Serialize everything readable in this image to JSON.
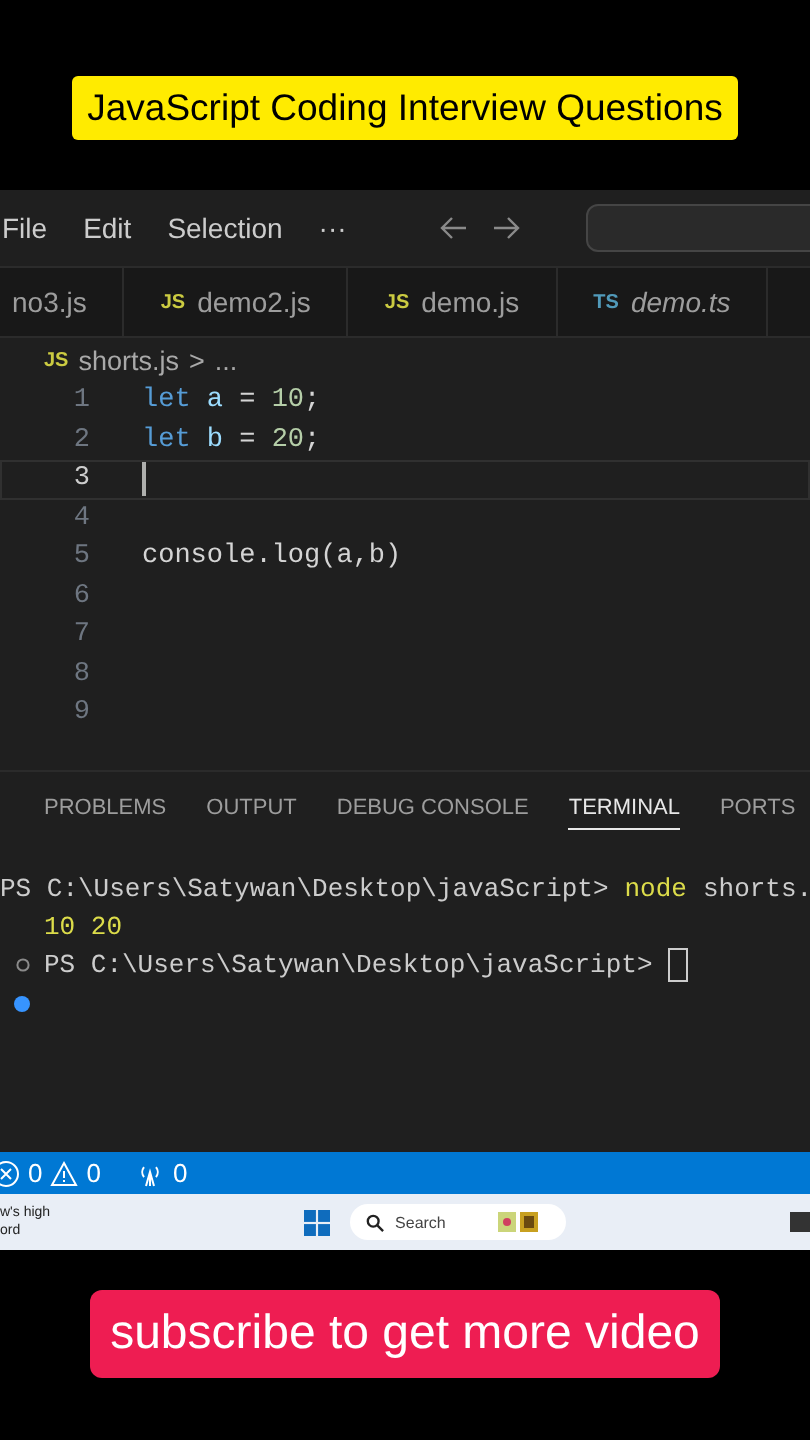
{
  "top_banner": {
    "text": "JavaScript Coding Interview Questions"
  },
  "menu": [
    "File",
    "Edit",
    "Selection",
    "···"
  ],
  "tabs": [
    {
      "label": "no3.js",
      "preview": false,
      "selected": false
    },
    {
      "label": "demo2.js",
      "icon": "JS",
      "preview": false,
      "selected": false
    },
    {
      "label": "demo.js",
      "icon": "JS",
      "preview": false,
      "selected": false
    },
    {
      "label": "demo.ts",
      "icon": "TS",
      "preview": true,
      "selected": false
    }
  ],
  "breadcrumb": {
    "icon": "JS",
    "file": "shorts.js",
    "separator": ">",
    "rest": "..."
  },
  "editor": {
    "lines": [
      {
        "number": "1",
        "current": false,
        "tokens": [
          {
            "kind": "keyword",
            "text": "let"
          },
          {
            "kind": "variable",
            "text": " a"
          },
          {
            "kind": "plain",
            "text": " = "
          },
          {
            "kind": "number",
            "text": "10"
          },
          {
            "kind": "plain",
            "text": ";"
          }
        ]
      },
      {
        "number": "2",
        "current": false,
        "tokens": [
          {
            "kind": "keyword",
            "text": "let"
          },
          {
            "kind": "variable",
            "text": " b"
          },
          {
            "kind": "plain",
            "text": " = "
          },
          {
            "kind": "number",
            "text": "20"
          },
          {
            "kind": "plain",
            "text": ";"
          }
        ]
      },
      {
        "number": "3",
        "current": true
      },
      {
        "number": "4",
        "current": false
      },
      {
        "number": "5",
        "current": false,
        "tokens": [
          {
            "kind": "plain",
            "text": "console.log(a,b)"
          }
        ]
      },
      {
        "number": "6",
        "current": false
      },
      {
        "number": "7",
        "current": false
      },
      {
        "number": "8",
        "current": false
      },
      {
        "number": "9",
        "current": false
      }
    ]
  },
  "panel_tabs": [
    {
      "label": "PROBLEMS",
      "selected": false
    },
    {
      "label": "OUTPUT",
      "selected": false
    },
    {
      "label": "DEBUG CONSOLE",
      "selected": false
    },
    {
      "label": "TERMINAL",
      "selected": true
    },
    {
      "label": "PORTS",
      "selected": false
    }
  ],
  "terminal": [
    {
      "prompt": "PS C:\\Users\\Satywan\\Desktop\\javaScript>",
      "command": "node",
      "args": "shorts.",
      "output": "10 20"
    },
    {
      "prompt": "PS C:\\Users\\Satywan\\Desktop\\javaScript>"
    }
  ],
  "status_bar": {
    "errors": "0",
    "warnings": "0",
    "ports": "0"
  },
  "taskbar": {
    "widget_lines": [
      "w's high",
      "ord"
    ],
    "search_placeholder": "Search"
  },
  "bottom_banner": {
    "text": "subscribe to get more video"
  }
}
